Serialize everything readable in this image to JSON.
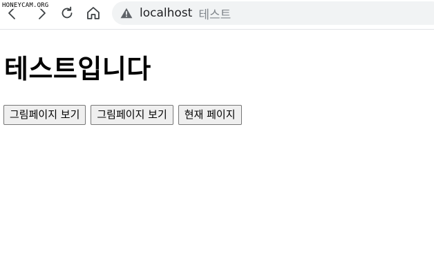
{
  "browser": {
    "watermark": "HONEYCAM.ORG",
    "url_host": "localhost",
    "tab_title": "테스트",
    "icons": {
      "back": "back-arrow-icon",
      "forward": "forward-arrow-icon",
      "reload": "reload-icon",
      "home": "home-icon",
      "security": "warning-triangle-icon"
    }
  },
  "page": {
    "heading": "테스트입니다",
    "buttons": [
      {
        "label": "그림페이지 보기"
      },
      {
        "label": "그림페이지 보기"
      },
      {
        "label": "현재 페이지"
      }
    ]
  }
}
